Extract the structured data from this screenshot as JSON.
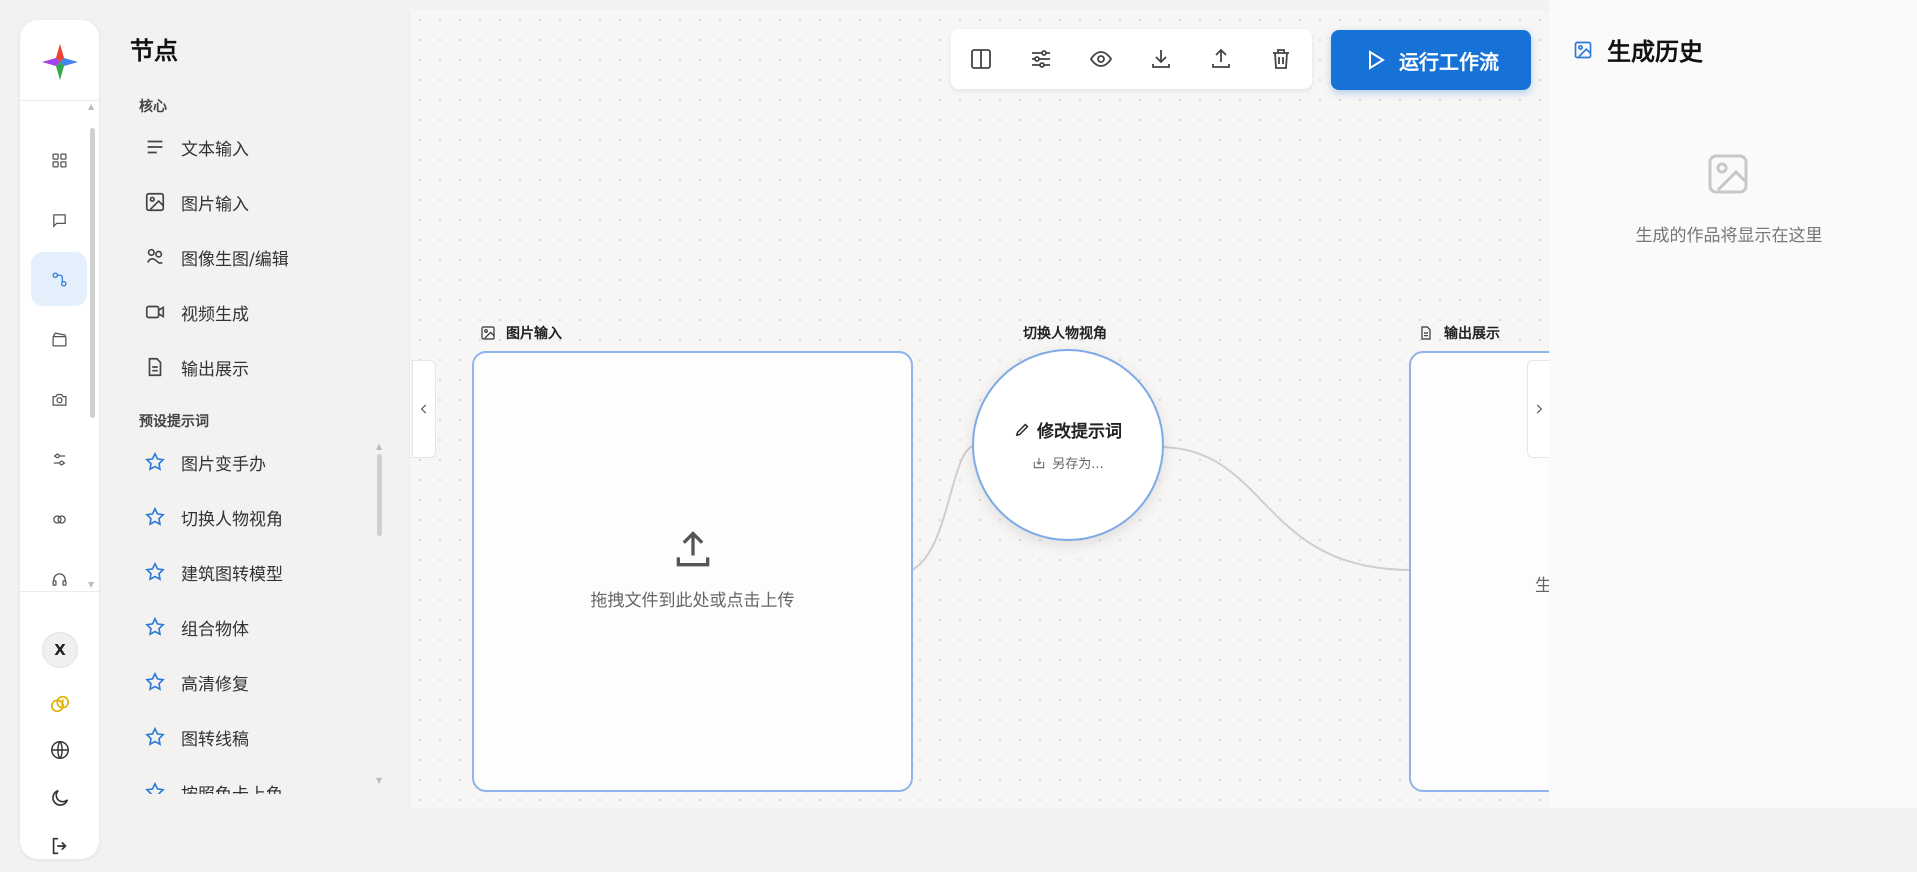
{
  "nodes_panel": {
    "title": "节点",
    "core_section": "核心",
    "core_items": [
      {
        "label": "文本输入",
        "icon": "text-lines-icon"
      },
      {
        "label": "图片输入",
        "icon": "image-icon"
      },
      {
        "label": "图像生图/编辑",
        "icon": "palette-icon"
      },
      {
        "label": "视频生成",
        "icon": "video-icon"
      },
      {
        "label": "输出展示",
        "icon": "document-icon"
      }
    ],
    "preset_section": "预设提示词",
    "preset_items": [
      {
        "label": "图片变手办",
        "icon": "star-icon"
      },
      {
        "label": "切换人物视角",
        "icon": "star-icon"
      },
      {
        "label": "建筑图转模型",
        "icon": "star-icon"
      },
      {
        "label": "组合物体",
        "icon": "star-icon"
      },
      {
        "label": "高清修复",
        "icon": "star-icon"
      },
      {
        "label": "图转线稿",
        "icon": "star-icon"
      },
      {
        "label": "按照色卡上色",
        "icon": "star-icon"
      }
    ]
  },
  "rail": {
    "avatar_letter": "X",
    "accent": "#2b7bd6"
  },
  "toolbar": {
    "run_label": "运行工作流",
    "run_color": "#1772d8"
  },
  "canvas": {
    "image_node": {
      "label": "图片输入",
      "upload_text": "拖拽文件到此处或点击上传"
    },
    "prompt_node": {
      "label": "切换人物视角",
      "edit_label": "修改提示词",
      "save_label": "另存为..."
    },
    "output_node": {
      "label": "输出展示",
      "body_text": "生"
    }
  },
  "history": {
    "title": "生成历史",
    "empty_text": "生成的作品将显示在这里"
  }
}
